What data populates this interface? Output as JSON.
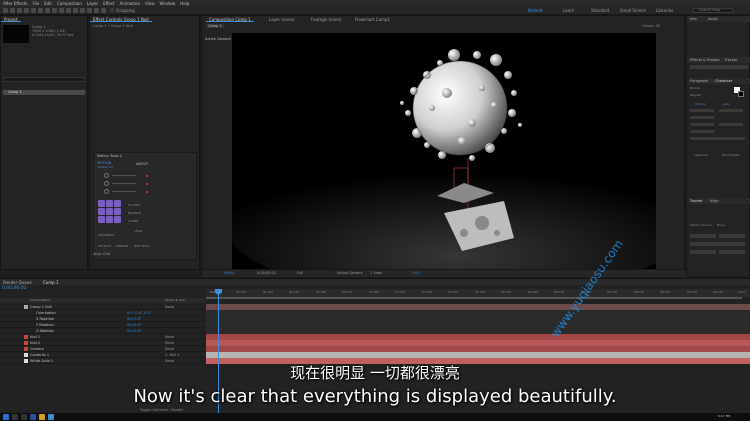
{
  "menu": [
    "After Effects",
    "File",
    "Edit",
    "Composition",
    "Layer",
    "Effect",
    "Animation",
    "View",
    "Window",
    "Help"
  ],
  "toolbar": {
    "snapping": "Snapping",
    "workspaces": [
      "Default",
      "Learn",
      "Standard",
      "Small Screen",
      "Libraries"
    ],
    "active_workspace": "Default",
    "search_placeholder": "Search Help"
  },
  "project": {
    "tab": "Project",
    "comp_name": "Comp 1",
    "comp_info": [
      "1920 x 1080 (1.00)",
      "Δ 0;00;10;00, 29.97 fps"
    ],
    "item": "Comp 1"
  },
  "effect_controls": {
    "tab": "Effect Controls Group 1 Null",
    "breadcrumb": "Comp 1 • Group 1 Null",
    "motion_tools": {
      "title": "Motion Tools 2",
      "motion_label": "MOTION",
      "motion_sub": "TOOLS 2.0",
      "about": "ABOUT",
      "labels": [
        "ELASTIC",
        "BOUNCE",
        "CLONE",
        "SEQUENCE",
        "EXTRACT",
        "MIRROR",
        "ANCHOR"
      ],
      "offset": "offset",
      "new_null": "NEW NULL"
    },
    "bottom_panel": "Align Grid"
  },
  "composition": {
    "tab": "Composition Comp 1",
    "other_tabs": [
      "Layer (none)",
      "Footage (none)",
      "Flowchart Comp1"
    ],
    "view_tab": "Comp 1",
    "active_camera": "Active Camera",
    "renderer": "Classic 3D",
    "footer": {
      "zoom": "(50%)",
      "timecode": "0;00;00;02",
      "resolution": "Full",
      "camera": "Active Camera",
      "views": "1 View",
      "offset": "+0.0"
    }
  },
  "right_panels": {
    "info": "Info",
    "audio": "Audio",
    "effects_presets": "Effects & Presets",
    "tracker": "Tracker",
    "paragraph": "Paragraph",
    "character": "Character",
    "font": "Bonda",
    "font_style": "Regular",
    "size": "160 px",
    "leading": "Auto",
    "tracker_panel": "Tracker",
    "align": "Align",
    "motion_source": "Motion Source:",
    "motion_source_value": "None",
    "ligatures": "Ligatures",
    "hindi_digits": "Hindi Digits",
    "colors": {
      "accent": "#3c8fe0",
      "swatch_fill": "#ffffff",
      "swatch_stroke": "#000000"
    }
  },
  "timeline": {
    "tabs": [
      "Render Queue",
      "Comp 1"
    ],
    "timecode": "0;00;00;02",
    "headers": [
      "Source Name",
      "Parent & Link"
    ],
    "ruler": [
      "00f",
      "00:15f",
      "01:00f",
      "01:15f",
      "02:00f",
      "02:15f",
      "03:00f",
      "03:15f",
      "04:00f",
      "04:15f",
      "05:00f",
      "05:15f",
      "06:00f",
      "06:15f",
      "07:00f",
      "07:15f",
      "08:00f",
      "08:15f",
      "09:00f",
      "09:15f",
      "10:0"
    ],
    "layers": [
      {
        "num": "1",
        "name": "Group 1 Null",
        "value": "",
        "parent": "None",
        "color": "#aaaaaa"
      },
      {
        "num": "",
        "name": "Orientation",
        "value": "0.0°,0.0°,0.0°",
        "parent": "",
        "color": ""
      },
      {
        "num": "",
        "name": "X Rotation",
        "value": "0x+0.0°",
        "parent": "",
        "color": ""
      },
      {
        "num": "",
        "name": "Y Rotation",
        "value": "0x+0.0°",
        "parent": "",
        "color": ""
      },
      {
        "num": "",
        "name": "Z Rotation",
        "value": "0x+0.0°",
        "parent": "",
        "color": ""
      },
      {
        "num": "2",
        "name": "Null 1",
        "value": "",
        "parent": "None",
        "color": "#c44"
      },
      {
        "num": "3",
        "name": "Null 2",
        "value": "",
        "parent": "None",
        "color": "#c44"
      },
      {
        "num": "4",
        "name": "Camera",
        "value": "",
        "parent": "None",
        "color": "#c44"
      },
      {
        "num": "5",
        "name": "Contents 1",
        "value": "",
        "parent": "1. Null 1",
        "color": "#ddd"
      },
      {
        "num": "6",
        "name": "White Solid 1",
        "value": "",
        "parent": "None",
        "color": "#ddd"
      }
    ],
    "toggle_label": "Toggle Switches / Modes"
  },
  "subtitles": {
    "cn": "现在很明显 一切都很漂亮",
    "en": "Now it's clear that everything is displayed beautifully."
  },
  "watermark": "www.yuqiaosu.com",
  "taskbar": {
    "clock": "9:17 PM"
  }
}
